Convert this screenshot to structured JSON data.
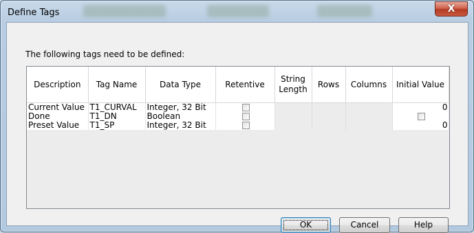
{
  "window": {
    "title": "Define Tags",
    "close_glyph": "X"
  },
  "prompt": "The following tags need to be defined:",
  "columns": [
    "Description",
    "Tag Name",
    "Data Type",
    "Retentive",
    "String\nLength",
    "Rows",
    "Columns",
    "Initial Value"
  ],
  "rows": [
    {
      "description": "Current Value",
      "tag_name": "T1_CURVAL",
      "data_type": "Integer, 32 Bit",
      "retentive": false,
      "initial_value": "0"
    },
    {
      "description": "Done",
      "tag_name": "T1_DN",
      "data_type": "Boolean",
      "retentive": false,
      "initial_value_checkbox": false
    },
    {
      "description": "Preset Value",
      "tag_name": "T1_SP",
      "data_type": "Integer, 32 Bit",
      "retentive": false,
      "initial_value": "0"
    }
  ],
  "buttons": {
    "ok": "OK",
    "cancel": "Cancel",
    "help": "Help"
  }
}
